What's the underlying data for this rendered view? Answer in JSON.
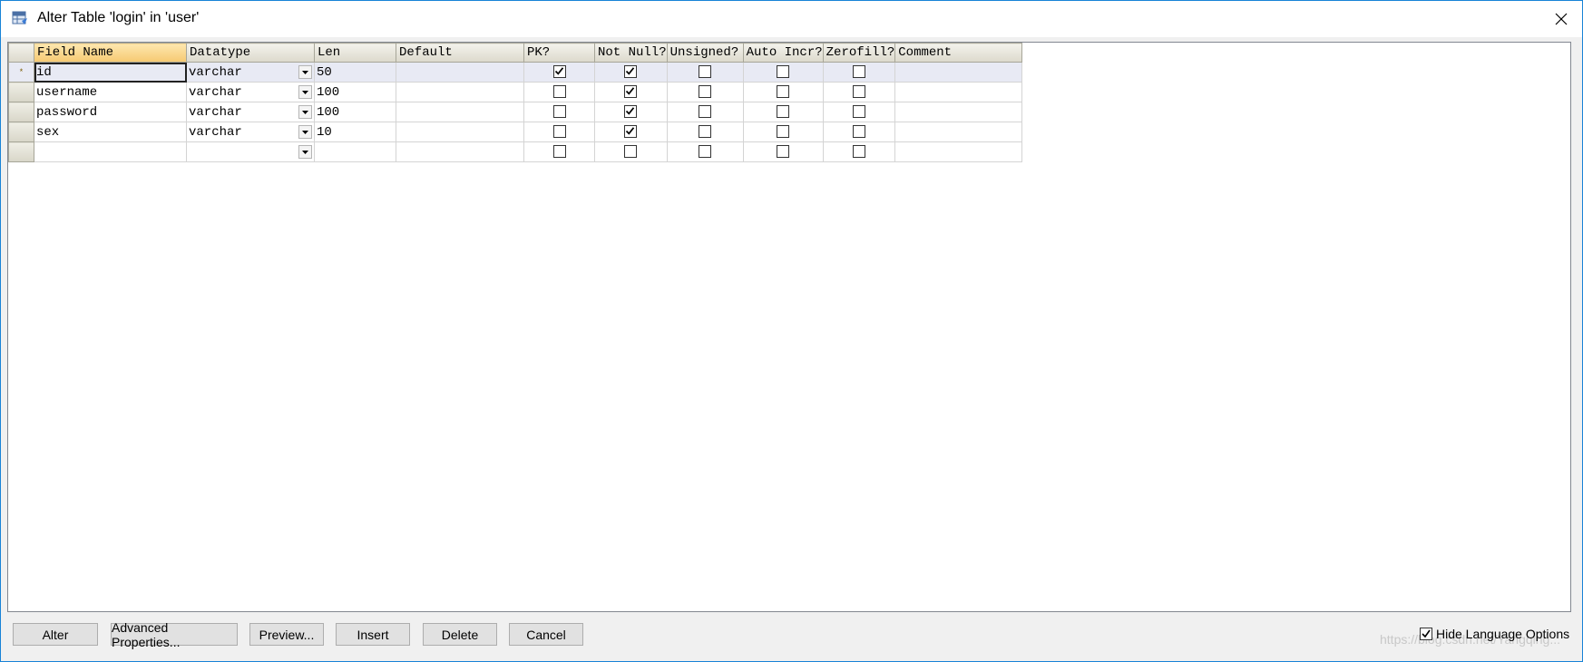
{
  "window": {
    "title": "Alter Table 'login' in 'user'"
  },
  "grid": {
    "columns": [
      "Field Name",
      "Datatype",
      "Len",
      "Default",
      "PK?",
      "Not Null?",
      "Unsigned?",
      "Auto Incr?",
      "Zerofill?",
      "Comment"
    ],
    "rows": [
      {
        "field": "id",
        "datatype": "varchar",
        "len": "50",
        "default": "",
        "pk": true,
        "notnull": true,
        "unsigned": false,
        "autoincr": false,
        "zerofill": false,
        "comment": ""
      },
      {
        "field": "username",
        "datatype": "varchar",
        "len": "100",
        "default": "",
        "pk": false,
        "notnull": true,
        "unsigned": false,
        "autoincr": false,
        "zerofill": false,
        "comment": ""
      },
      {
        "field": "password",
        "datatype": "varchar",
        "len": "100",
        "default": "",
        "pk": false,
        "notnull": true,
        "unsigned": false,
        "autoincr": false,
        "zerofill": false,
        "comment": ""
      },
      {
        "field": "sex",
        "datatype": "varchar",
        "len": "10",
        "default": "",
        "pk": false,
        "notnull": true,
        "unsigned": false,
        "autoincr": false,
        "zerofill": false,
        "comment": ""
      },
      {
        "field": "",
        "datatype": "",
        "len": "",
        "default": "",
        "pk": false,
        "notnull": false,
        "unsigned": false,
        "autoincr": false,
        "zerofill": false,
        "comment": ""
      }
    ],
    "current_row_marker": "*"
  },
  "buttons": {
    "alter": "Alter",
    "advanced": "Advanced Properties...",
    "preview": "Preview...",
    "insert": "Insert",
    "delete": "Delete",
    "cancel": "Cancel"
  },
  "hide_language": {
    "label": "Hide Language Options",
    "checked": true
  },
  "watermark": "https://blog.csdn.net/Yangqing..."
}
